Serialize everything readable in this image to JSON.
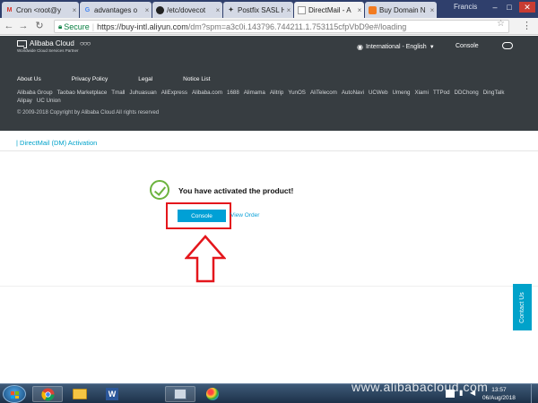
{
  "browser": {
    "tabs": [
      {
        "title": "Cron <root@y",
        "icon": "gmail-icon"
      },
      {
        "title": "advantages o",
        "icon": "google-icon"
      },
      {
        "title": "/etc/dovecot",
        "icon": "github-icon"
      },
      {
        "title": "Postfix SASL H",
        "icon": "blog-icon"
      },
      {
        "title": "DirectMail - A",
        "icon": "page-icon"
      },
      {
        "title": "Buy Domain N",
        "icon": "alibaba-icon"
      }
    ],
    "window_user": "Francis",
    "address": {
      "secure_label": "Secure",
      "url_host": "https://buy-intl.aliyun.com",
      "url_path": "/dm?spm=a3c0i.143796.744211.1.753115cfpVbD9e#/loading"
    }
  },
  "header": {
    "logo_text": "Alibaba Cloud",
    "logo_subtitle": "Worldwide Cloud Services Partner",
    "language": "International - English",
    "console_link": "Console"
  },
  "footer": {
    "links": [
      "About Us",
      "Privacy Policy",
      "Legal",
      "Notice List"
    ],
    "partners": [
      "Alibaba Group",
      "Taobao Marketplace",
      "Tmall",
      "Juhuasuan",
      "AliExpress",
      "Alibaba.com",
      "1688",
      "Alimama",
      "Alitrip",
      "YunOS",
      "AliTelecom",
      "AutoNavi",
      "UCWeb",
      "Umeng",
      "Xiami",
      "TTPod",
      "DDChong",
      "DingTalk",
      "Alipay",
      "UC Union"
    ],
    "copyright": "© 2009-2018 Copyright by Alibaba Cloud All rights reserved"
  },
  "main": {
    "heading": "| DirectMail (DM) Activation",
    "success_message": "You have activated the product!",
    "console_button": "Console",
    "view_order_link": "View Order"
  },
  "contact_tab": "Contact Us",
  "taskbar": {
    "apps": [
      "chrome-icon",
      "explorer-icon",
      "word-icon",
      "network-icon",
      "paint-icon"
    ],
    "time": "13:57",
    "date": "06/Aug/2018"
  },
  "watermark": "www.alibabacloud.com",
  "colors": {
    "header_bg": "#373d41",
    "accent": "#00a0d6",
    "success": "#6cb33e",
    "highlight": "#e4161c"
  }
}
